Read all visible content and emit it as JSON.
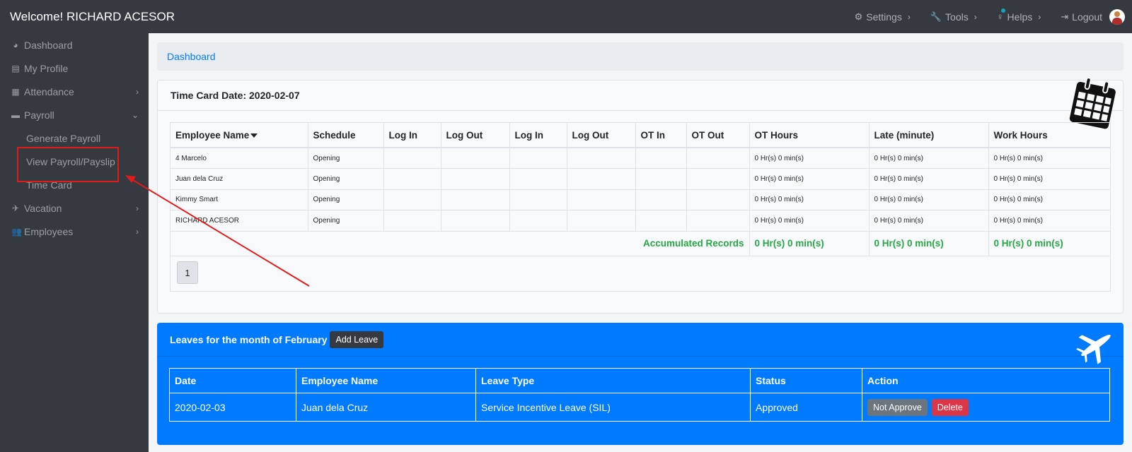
{
  "header": {
    "welcome": "Welcome! RICHARD ACESOR",
    "nav": [
      {
        "label": "Settings",
        "icon": "gears-icon"
      },
      {
        "label": "Tools",
        "icon": "wrench-icon"
      },
      {
        "label": "Helps",
        "icon": "lightbulb-icon"
      },
      {
        "label": "Logout",
        "icon": "sign-out-icon"
      }
    ]
  },
  "sidebar": {
    "items": [
      {
        "label": "Dashboard",
        "icon": "dashboard-icon"
      },
      {
        "label": "My Profile",
        "icon": "id-card-icon"
      },
      {
        "label": "Attendance",
        "icon": "calendar-icon"
      },
      {
        "label": "Payroll",
        "icon": "file-icon"
      },
      {
        "label": "Vacation",
        "icon": "plane-icon"
      },
      {
        "label": "Employees",
        "icon": "users-icon"
      }
    ],
    "payroll_sub": [
      "Generate Payroll",
      "View Payroll/Payslip",
      "Time Card"
    ]
  },
  "breadcrumb": {
    "label": "Dashboard"
  },
  "timecard": {
    "title": "Time Card Date: 2020-02-07",
    "columns": [
      "Employee Name",
      "Schedule",
      "Log In",
      "Log Out",
      "Log In",
      "Log Out",
      "OT In",
      "OT Out",
      "OT Hours",
      "Late (minute)",
      "Work Hours"
    ],
    "rows": [
      {
        "name": "4 Marcelo",
        "schedule": "Opening",
        "ot_hours": "0 Hr(s) 0 min(s)",
        "late": "0 Hr(s) 0 min(s)",
        "work_hours": "0 Hr(s) 0 min(s)"
      },
      {
        "name": "Juan dela Cruz",
        "schedule": "Opening",
        "ot_hours": "0 Hr(s) 0 min(s)",
        "late": "0 Hr(s) 0 min(s)",
        "work_hours": "0 Hr(s) 0 min(s)"
      },
      {
        "name": "Kimmy Smart",
        "schedule": "Opening",
        "ot_hours": "0 Hr(s) 0 min(s)",
        "late": "0 Hr(s) 0 min(s)",
        "work_hours": "0 Hr(s) 0 min(s)"
      },
      {
        "name": "RICHARD ACESOR",
        "schedule": "Opening",
        "ot_hours": "0 Hr(s) 0 min(s)",
        "late": "0 Hr(s) 0 min(s)",
        "work_hours": "0 Hr(s) 0 min(s)"
      }
    ],
    "accumulated": {
      "label": "Accumulated Records",
      "ot_hours": "0 Hr(s) 0 min(s)",
      "late": "0 Hr(s) 0 min(s)",
      "work_hours": "0 Hr(s) 0 min(s)"
    },
    "page": "1"
  },
  "leaves": {
    "title": "Leaves for the month of February",
    "add_label": "Add Leave",
    "columns": [
      "Date",
      "Employee Name",
      "Leave Type",
      "Status",
      "Action"
    ],
    "rows": [
      {
        "date": "2020-02-03",
        "employee": "Juan dela Cruz",
        "type": "Service Incentive Leave (SIL)",
        "status": "Approved",
        "btn_not_approve": "Not Approve",
        "btn_delete": "Delete"
      }
    ]
  },
  "colors": {
    "sidebar": "#343a40",
    "accent": "#007bff",
    "success": "#28a745",
    "danger": "#dc3545",
    "annotation": "#e41a1a"
  }
}
